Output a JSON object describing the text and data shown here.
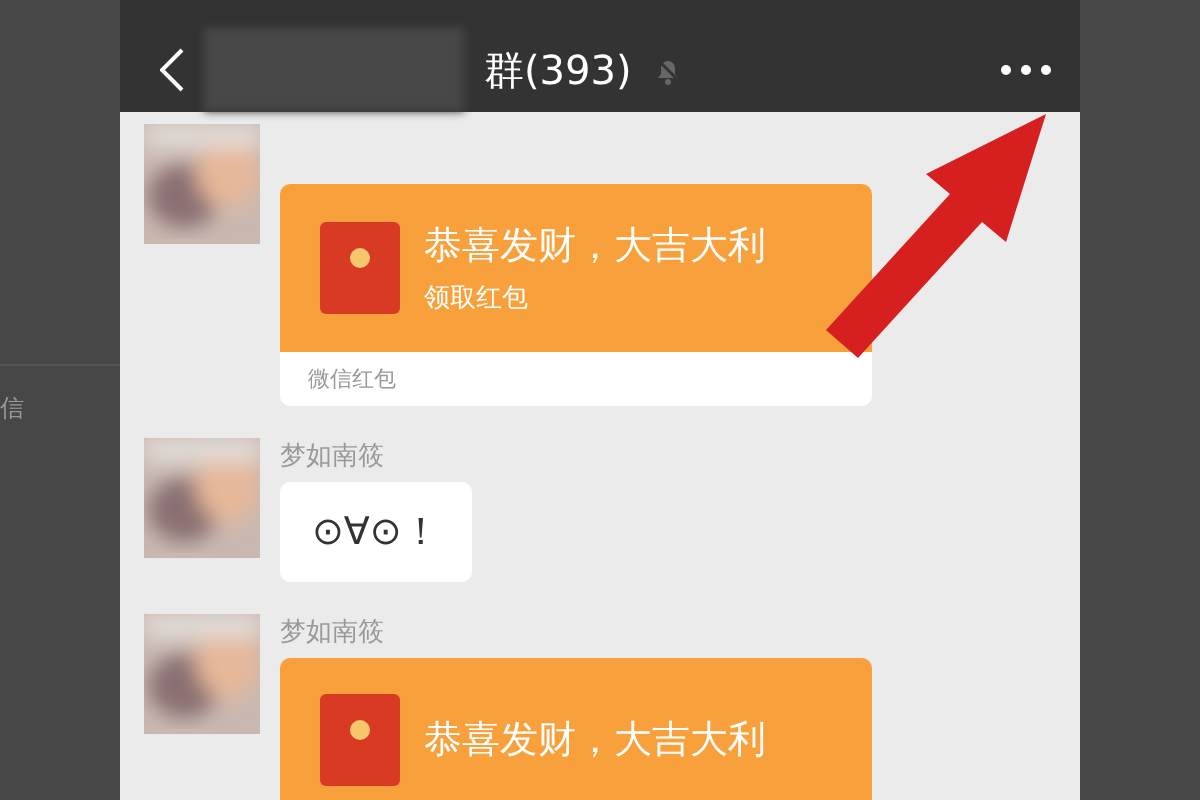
{
  "side_label": "信",
  "header": {
    "title": "群(393)",
    "muted": true
  },
  "messages": [
    {
      "kind": "red_packet",
      "title": "恭喜发财，大吉大利",
      "action": "领取红包",
      "footer": "微信红包"
    },
    {
      "kind": "text",
      "sender": "梦如南筱",
      "text": "⊙∀⊙！"
    },
    {
      "kind": "red_packet",
      "sender": "梦如南筱",
      "title": "恭喜发财，大吉大利"
    }
  ]
}
